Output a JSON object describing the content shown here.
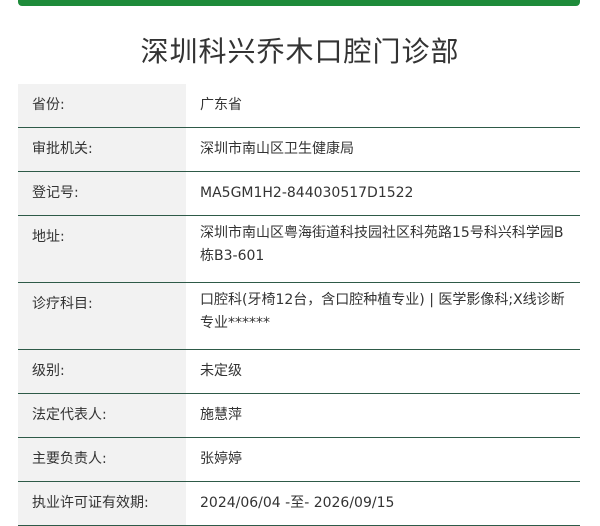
{
  "title": "深圳科兴乔木口腔门诊部",
  "accent_color": "#1e8b3a",
  "rows": [
    {
      "label": "省份:",
      "value": "广东省"
    },
    {
      "label": "审批机关:",
      "value": "深圳市南山区卫生健康局"
    },
    {
      "label": "登记号:",
      "value": "MA5GM1H2-844030517D1522"
    },
    {
      "label": "地址:",
      "value": "深圳市南山区粤海街道科技园社区科苑路15号科兴科学园B栋B3-601"
    },
    {
      "label": "诊疗科目:",
      "value": "口腔科(牙椅12台，含口腔种植专业) | 医学影像科;X线诊断专业******"
    },
    {
      "label": "级别:",
      "value": "未定级"
    },
    {
      "label": "法定代表人:",
      "value": "施慧萍"
    },
    {
      "label": "主要负责人:",
      "value": "张婷婷"
    },
    {
      "label": "执业许可证有效期:",
      "value": "2024/06/04 -至- 2026/09/15"
    }
  ]
}
